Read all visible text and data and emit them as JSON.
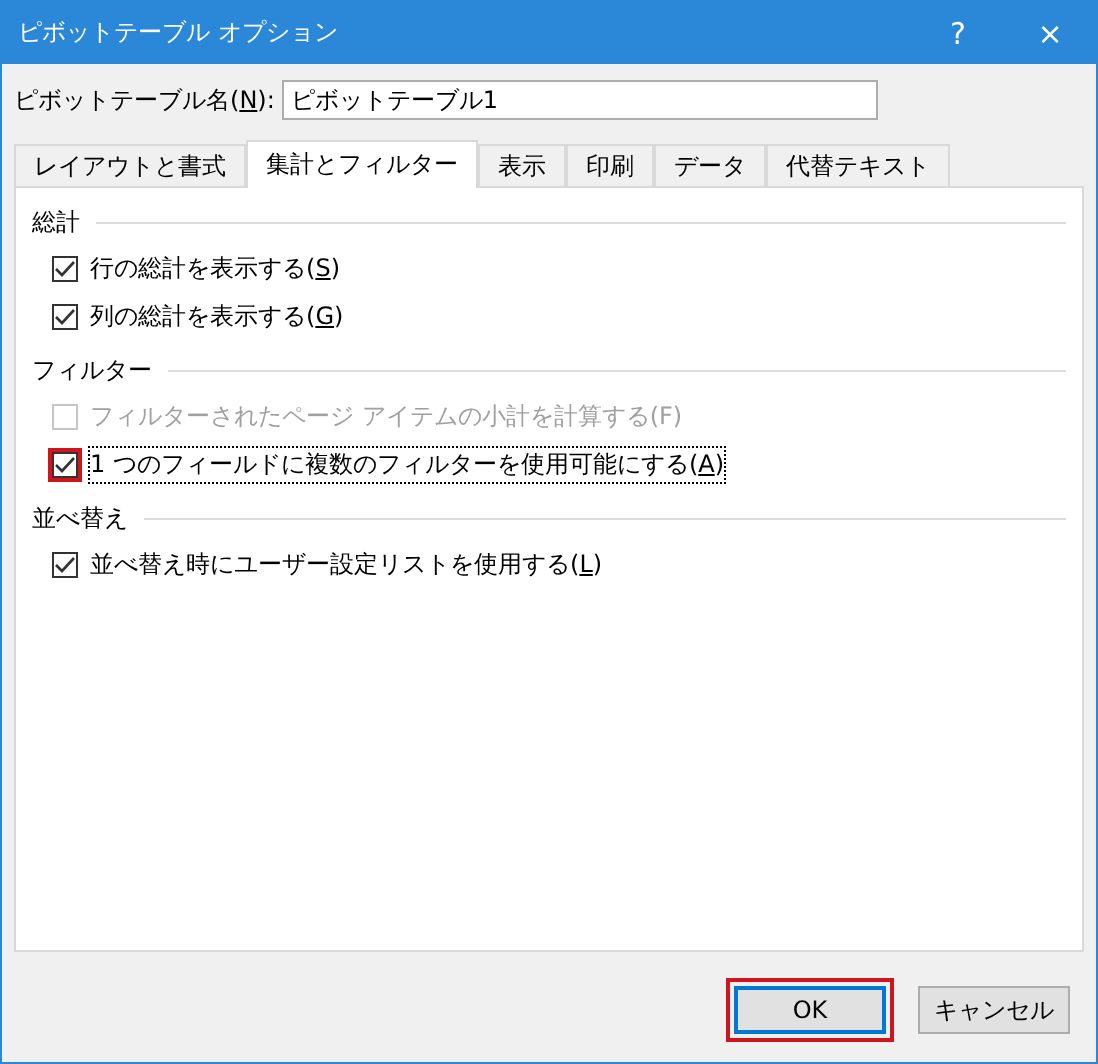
{
  "window": {
    "title": "ピボットテーブル オプション",
    "help": "?",
    "close": "×"
  },
  "name_field": {
    "label_before": "ピボットテーブル名(",
    "key": "N",
    "label_after": "):",
    "value": "ピボットテーブル1"
  },
  "tabs": [
    {
      "label": "レイアウトと書式",
      "selected": false
    },
    {
      "label": "集計とフィルター",
      "selected": true
    },
    {
      "label": "表示",
      "selected": false
    },
    {
      "label": "印刷",
      "selected": false
    },
    {
      "label": "データ",
      "selected": false
    },
    {
      "label": "代替テキスト",
      "selected": false
    }
  ],
  "sections": [
    {
      "title": "総計",
      "options": [
        {
          "label_before": "行の総計を表示する(",
          "key": "S",
          "label_after": ")",
          "checked": true,
          "disabled": false,
          "focused": false,
          "highlighted": false
        },
        {
          "label_before": "列の総計を表示する(",
          "key": "G",
          "label_after": ")",
          "checked": true,
          "disabled": false,
          "focused": false,
          "highlighted": false
        }
      ]
    },
    {
      "title": "フィルター",
      "options": [
        {
          "label_before": "フィルターされたページ アイテムの小計を計算する(F)",
          "checked": false,
          "disabled": true,
          "focused": false,
          "highlighted": false
        },
        {
          "label_before": "1 つのフィールドに複数のフィルターを使用可能にする(",
          "key": "A",
          "label_after": ")",
          "checked": true,
          "disabled": false,
          "focused": true,
          "highlighted": true
        }
      ]
    },
    {
      "title": "並べ替え",
      "options": [
        {
          "label_before": "並べ替え時にユーザー設定リストを使用する(",
          "key": "L",
          "label_after": ")",
          "checked": true,
          "disabled": false,
          "focused": false,
          "highlighted": false
        }
      ]
    }
  ],
  "buttons": [
    {
      "label": "OK",
      "default": true,
      "highlighted": true
    },
    {
      "label": "キャンセル",
      "default": false,
      "highlighted": false
    }
  ]
}
